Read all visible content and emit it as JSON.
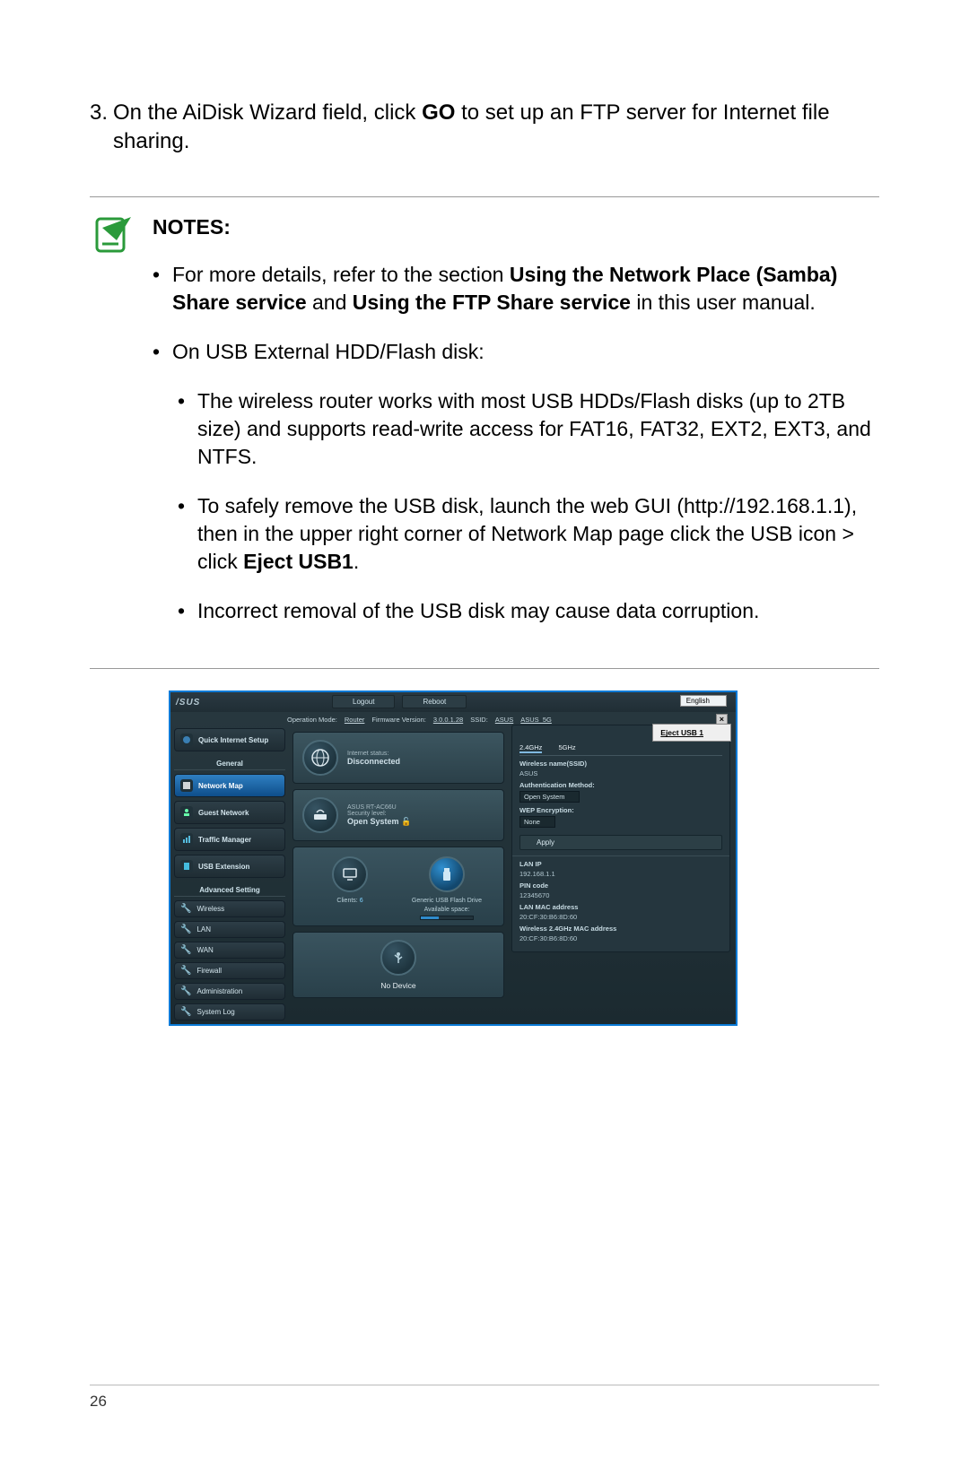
{
  "step": {
    "number": "3.",
    "text_pre": "On the AiDisk Wizard field, click ",
    "bold_go": "GO",
    "text_post": " to set up an FTP server for Internet file sharing."
  },
  "notes": {
    "title": "NOTES",
    "b1_pre": "For more details, refer to the section ",
    "b1_bold": "Using the Network Place (Samba) Share service",
    "b1_mid": " and ",
    "b1_bold2": "Using the FTP Share service",
    "b1_post": " in this user manual.",
    "b2": "On USB External HDD/Flash disk:",
    "b2a": "The wireless router works with most USB HDDs/Flash disks (up to 2TB size) and supports read-write access for FAT16, FAT32, EXT2, EXT3, and NTFS.",
    "b2b_pre": "To safely remove the USB disk, launch the web GUI (http://192.168.1.1), then in the upper right corner of Network Map page click the USB icon > click ",
    "b2b_bold": "Eject USB1",
    "b2b_post": ".",
    "b2c": "Incorrect removal of the USB disk may cause data corruption."
  },
  "router": {
    "logo": "/SUS",
    "logout": "Logout",
    "reboot": "Reboot",
    "language": "English",
    "opmode_label": "Operation Mode:",
    "opmode_value": "Router",
    "fw_label": "Firmware Version:",
    "fw_value": "3.0.0.1.28",
    "ssid_label": "SSID:",
    "ssid1": "ASUS",
    "ssid2": "ASUS_5G",
    "sidebar": {
      "qis": "Quick Internet Setup",
      "general": "General",
      "network_map": "Network Map",
      "guest": "Guest Network",
      "traffic": "Traffic Manager",
      "usb_ext": "USB Extension",
      "advanced": "Advanced Setting",
      "wireless": "Wireless",
      "lan": "LAN",
      "wan": "WAN",
      "firewall": "Firewall",
      "admin": "Administration",
      "syslog": "System Log"
    },
    "mid": {
      "internet_status_label": "Internet status:",
      "internet_status": "Disconnected",
      "model": "ASUS RT-AC66U",
      "sec_label": "Security level:",
      "sec_value": "Open System",
      "clients_label": "Clients:",
      "clients_value": "6",
      "usb_drive": "Generic USB Flash Drive",
      "avail_space": "Available space:",
      "no_device": "No Device"
    },
    "right": {
      "eject": "Eject USB 1",
      "tab24": "2.4GHz",
      "tab5": "5GHz",
      "wname_label": "Wireless name(SSID)",
      "wname_value": "ASUS",
      "auth_label": "Authentication Method:",
      "auth_value": "Open System",
      "wep_label": "WEP Encryption:",
      "wep_value": "None",
      "apply": "Apply",
      "lanip_label": "LAN IP",
      "lanip_value": "192.168.1.1",
      "pin_label": "PIN code",
      "pin_value": "12345670",
      "mac_label": "LAN MAC address",
      "mac_value": "20:CF:30:B6:8D:60",
      "wmac_label": "Wireless 2.4GHz MAC address",
      "wmac_value": "20:CF:30:B6:8D:60"
    }
  },
  "page_number": "26"
}
